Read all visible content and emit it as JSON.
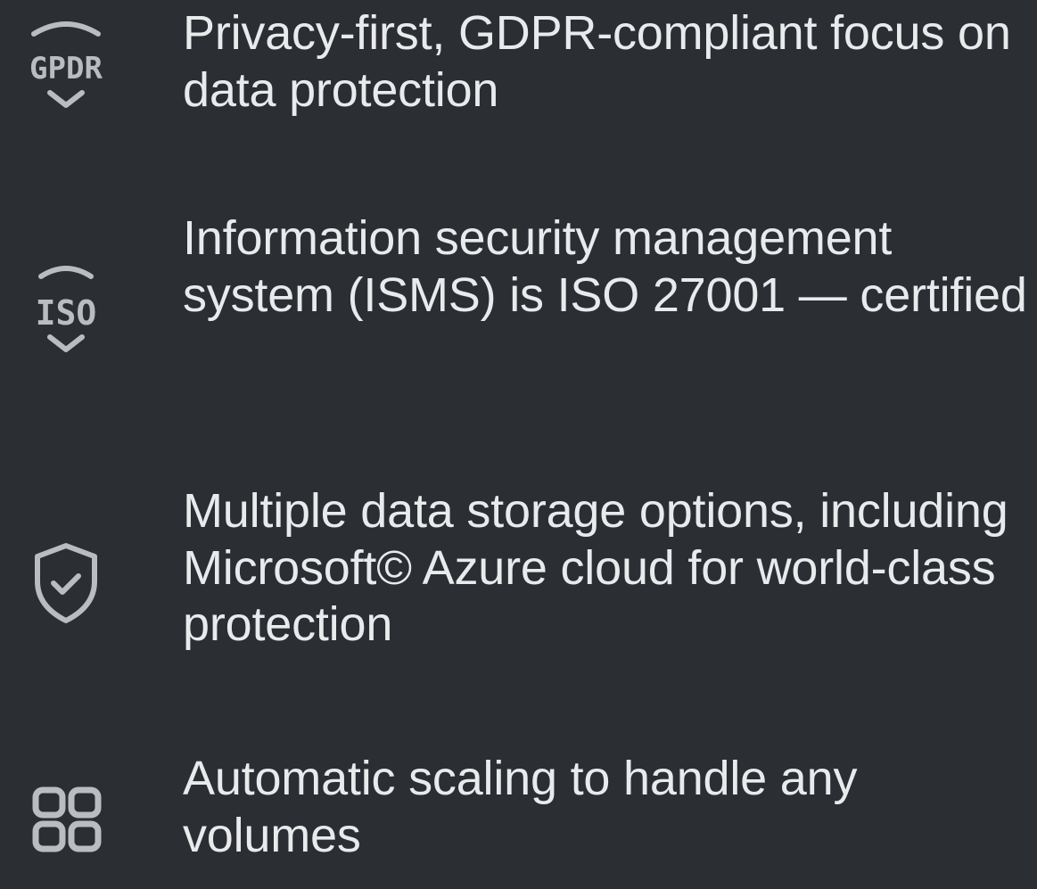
{
  "features": [
    {
      "icon": "gdpr-shield-icon",
      "badge_text": "GPDR",
      "text": "Privacy-first, GDPR-compliant focus on data protection"
    },
    {
      "icon": "iso-shield-icon",
      "badge_text": "ISO",
      "text": "Information security management system (ISMS) is ISO 27001 — certified"
    },
    {
      "icon": "shield-check-icon",
      "text": "Multiple data storage options, including Microsoft© Azure cloud for world-class protection"
    },
    {
      "icon": "grid-squares-icon",
      "text": "Automatic scaling to handle any volumes"
    }
  ],
  "colors": {
    "background": "#2b2e33",
    "text": "#e9eaec",
    "icon": "#b9bcc1"
  }
}
